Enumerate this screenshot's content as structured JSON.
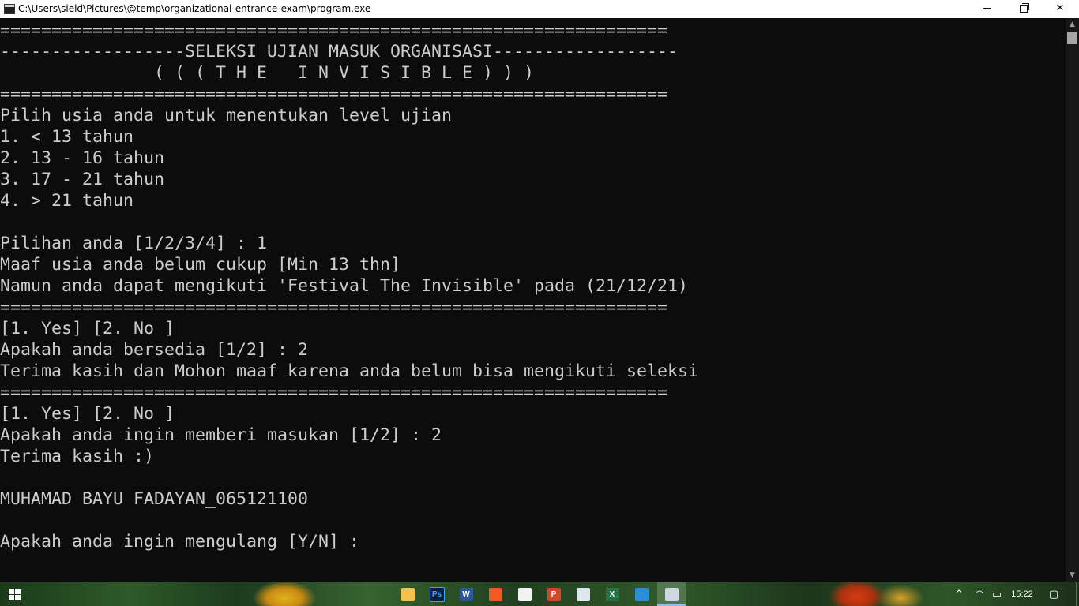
{
  "window": {
    "title": "C:\\Users\\sield\\Pictures\\@temp\\organizational-entrance-exam\\program.exe",
    "minimize_icon": "minimize-icon",
    "maximize_icon": "restore-icon",
    "close_icon": "close-icon",
    "close_glyph": "✕"
  },
  "console": {
    "foreground_color": "#cccccc",
    "background_color": "#0c0c0c",
    "lines": [
      "=================================================================",
      "------------------SELEKSI UJIAN MASUK ORGANISASI------------------",
      "               ( ( ( T H E   I N V I S I B L E ) ) )",
      "=================================================================",
      "Pilih usia anda untuk menentukan level ujian",
      "1. < 13 tahun",
      "2. 13 - 16 tahun",
      "3. 17 - 21 tahun",
      "4. > 21 tahun",
      "",
      "Pilihan anda [1/2/3/4] : 1",
      "Maaf usia anda belum cukup [Min 13 thn]",
      "Namun anda dapat mengikuti 'Festival The Invisible' pada (21/12/21)",
      "=================================================================",
      "[1. Yes] [2. No ]",
      "Apakah anda bersedia [1/2] : 2",
      "Terima kasih dan Mohon maaf karena anda belum bisa mengikuti seleksi",
      "=================================================================",
      "[1. Yes] [2. No ]",
      "Apakah anda ingin memberi masukan [1/2] : 2",
      "Terima kasih :)",
      "",
      "MUHAMAD BAYU FADAYAN_065121100",
      "",
      "Apakah anda ingin mengulang [Y/N] :"
    ]
  },
  "scrollbar": {
    "up_glyph": "▲",
    "down_glyph": "▼"
  },
  "taskbar": {
    "start_icon": "windows-start-icon",
    "apps": [
      {
        "name": "file-explorer-icon",
        "glyph": "",
        "color": "#f2c14e"
      },
      {
        "name": "photoshop-icon",
        "glyph": "Ps",
        "color": "#0a1f3a"
      },
      {
        "name": "word-icon",
        "glyph": "W",
        "color": "#2b579a"
      },
      {
        "name": "brave-icon",
        "glyph": "",
        "color": "#f25a22"
      },
      {
        "name": "store-icon",
        "glyph": "",
        "color": "#f2f2f2"
      },
      {
        "name": "powerpoint-icon",
        "glyph": "P",
        "color": "#d24726"
      },
      {
        "name": "paint-icon",
        "glyph": "",
        "color": "#dfe7ee"
      },
      {
        "name": "excel-icon",
        "glyph": "X",
        "color": "#217346"
      },
      {
        "name": "vscode-icon",
        "glyph": "",
        "color": "#2a8fd8"
      },
      {
        "name": "console-app-icon",
        "glyph": "",
        "color": "#cfd8e0"
      }
    ],
    "tray": {
      "chevron_glyph": "⌃",
      "wifi_glyph": "◠",
      "battery_glyph": "▭",
      "notification_glyph": "▢",
      "clock": "15:22"
    }
  }
}
